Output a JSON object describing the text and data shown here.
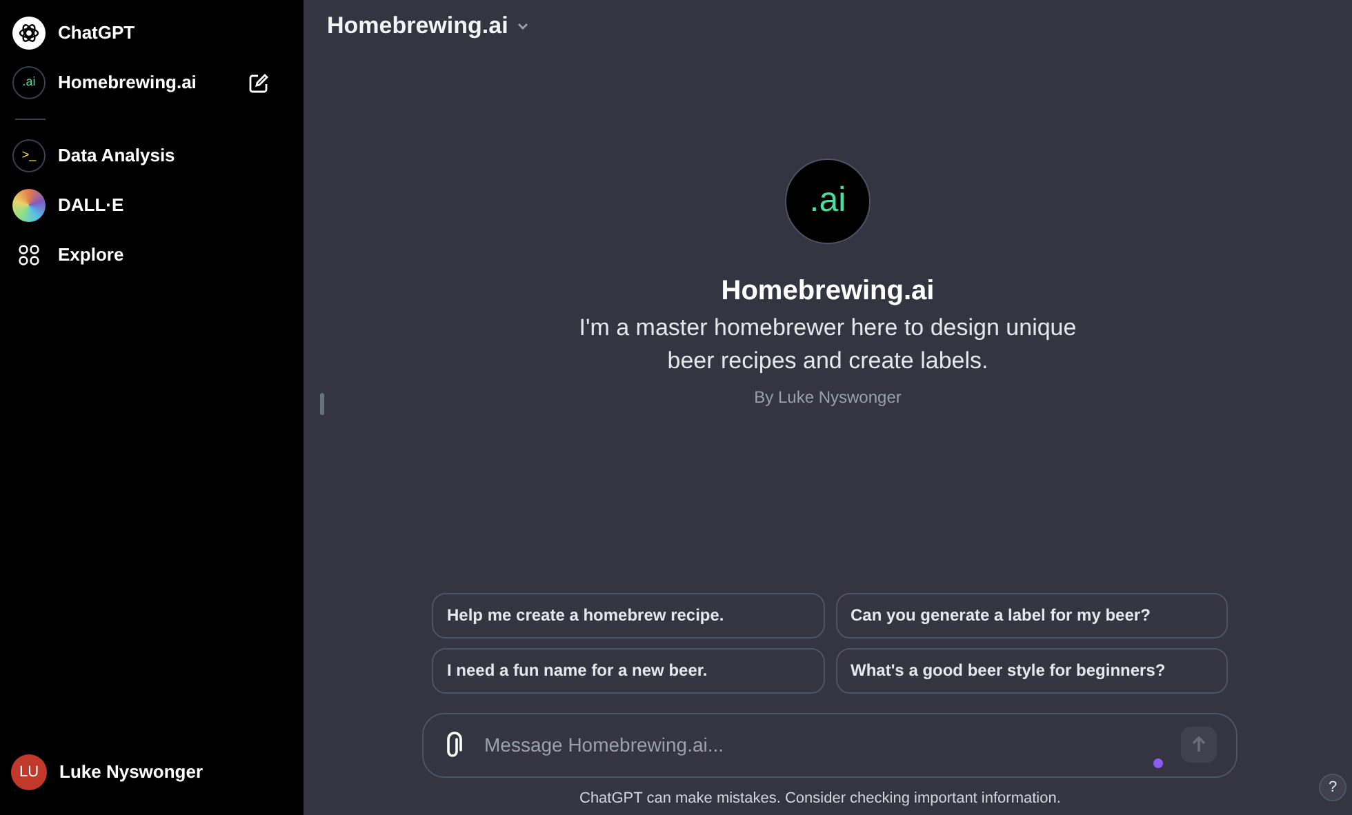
{
  "sidebar": {
    "items": [
      {
        "kind": "openai",
        "label": "ChatGPT"
      },
      {
        "kind": "badge",
        "badge": ".ai",
        "label": "Homebrewing.ai",
        "editable": true
      },
      {
        "kind": "divider"
      },
      {
        "kind": "terminal",
        "badge": ">_",
        "label": "Data Analysis"
      },
      {
        "kind": "gradient",
        "label": "DALL·E"
      },
      {
        "kind": "grid",
        "label": "Explore"
      }
    ],
    "user": {
      "initials": "LU",
      "name": "Luke Nyswonger"
    }
  },
  "header": {
    "title": "Homebrewing.ai"
  },
  "gpt": {
    "badge": ".ai",
    "name": "Homebrewing.ai",
    "description": "I'm a master homebrewer here to design unique beer recipes and create labels.",
    "author": "By Luke Nyswonger"
  },
  "suggestions": [
    "Help me create a homebrew recipe.",
    "Can you generate a label for my beer?",
    "I need a fun name for a new beer.",
    "What's a good beer style for beginners?"
  ],
  "composer": {
    "placeholder": "Message Homebrewing.ai..."
  },
  "footer": "ChatGPT can make mistakes. Consider checking important information.",
  "help": "?"
}
